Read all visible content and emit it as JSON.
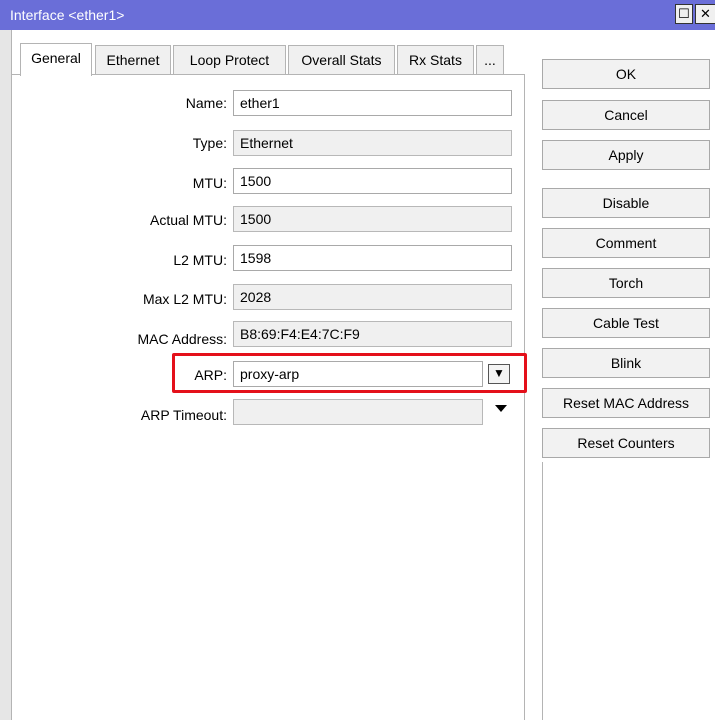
{
  "window": {
    "title": "Interface <ether1>",
    "maximize_glyph": "☐",
    "close_glyph": "✕"
  },
  "tabs": [
    {
      "label": "General",
      "active": true
    },
    {
      "label": "Ethernet",
      "active": false
    },
    {
      "label": "Loop Protect",
      "active": false
    },
    {
      "label": "Overall Stats",
      "active": false
    },
    {
      "label": "Rx Stats",
      "active": false
    },
    {
      "label": "...",
      "active": false
    }
  ],
  "fields": {
    "name": {
      "label": "Name:",
      "value": "ether1"
    },
    "type": {
      "label": "Type:",
      "value": "Ethernet"
    },
    "mtu": {
      "label": "MTU:",
      "value": "1500"
    },
    "actual_mtu": {
      "label": "Actual MTU:",
      "value": "1500"
    },
    "l2_mtu": {
      "label": "L2 MTU:",
      "value": "1598"
    },
    "max_l2_mtu": {
      "label": "Max L2 MTU:",
      "value": "2028"
    },
    "mac_address": {
      "label": "MAC Address:",
      "value": "B8:69:F4:E4:7C:F9"
    },
    "arp": {
      "label": "ARP:",
      "value": "proxy-arp"
    },
    "arp_timeout": {
      "label": "ARP Timeout:",
      "value": ""
    }
  },
  "buttons": {
    "ok": "OK",
    "cancel": "Cancel",
    "apply": "Apply",
    "disable": "Disable",
    "comment": "Comment",
    "torch": "Torch",
    "cable_test": "Cable Test",
    "blink": "Blink",
    "reset_mac": "Reset MAC Address",
    "reset_counters": "Reset Counters"
  },
  "colors": {
    "titlebar": "#6a6ed8",
    "highlight": "#e4101a"
  }
}
